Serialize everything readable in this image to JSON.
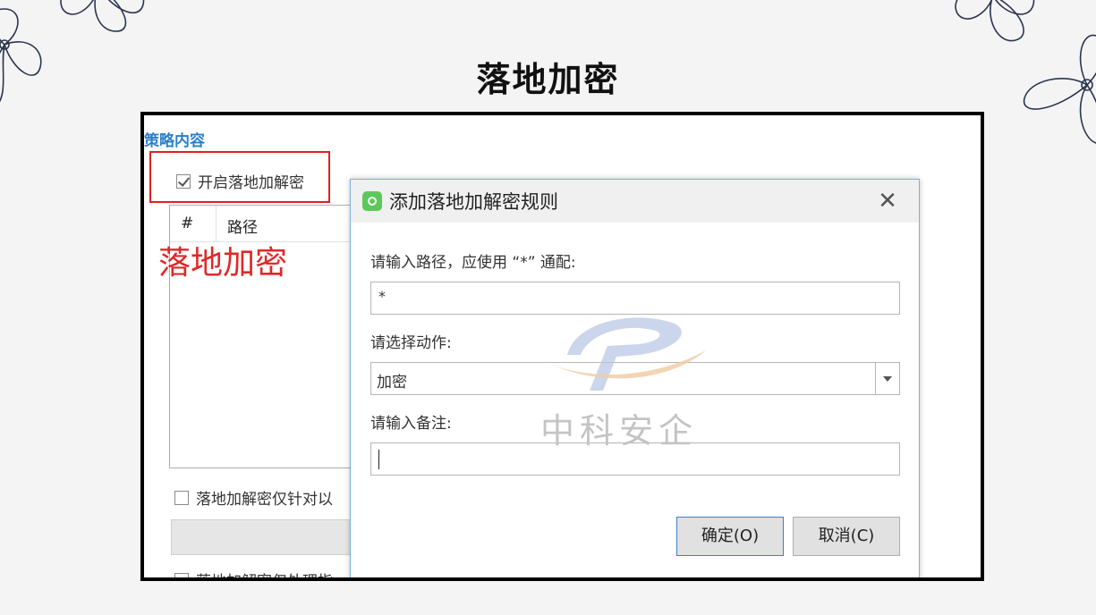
{
  "page_title": "落地加密",
  "panel": {
    "section_label": "策略内容",
    "enable_checkbox": {
      "label": "开启落地加解密",
      "checked": true
    },
    "list": {
      "columns": [
        "#",
        "路径"
      ]
    },
    "annotation": "落地加密",
    "option1_label": "落地加解密仅针对以",
    "option2_label": "落地加解密仅处理指"
  },
  "dialog": {
    "title": "添加落地加解密规则",
    "path_label": "请输入路径，应使用 “*” 通配:",
    "path_value": "*",
    "action_label": "请选择动作:",
    "action_value": "加密",
    "note_label": "请输入备注:",
    "note_value": "",
    "ok_button": "确定(O)",
    "cancel_button": "取消(C)"
  },
  "watermark": {
    "text": "中科安企"
  },
  "colors": {
    "annotation_red": "#e02828",
    "section_blue": "#2a7fc9",
    "dialog_border": "#7fb0df"
  },
  "icons": {
    "close": "close-icon",
    "app": "app-icon",
    "dropdown": "chevron-down-icon",
    "decoration": "flower-icon"
  }
}
